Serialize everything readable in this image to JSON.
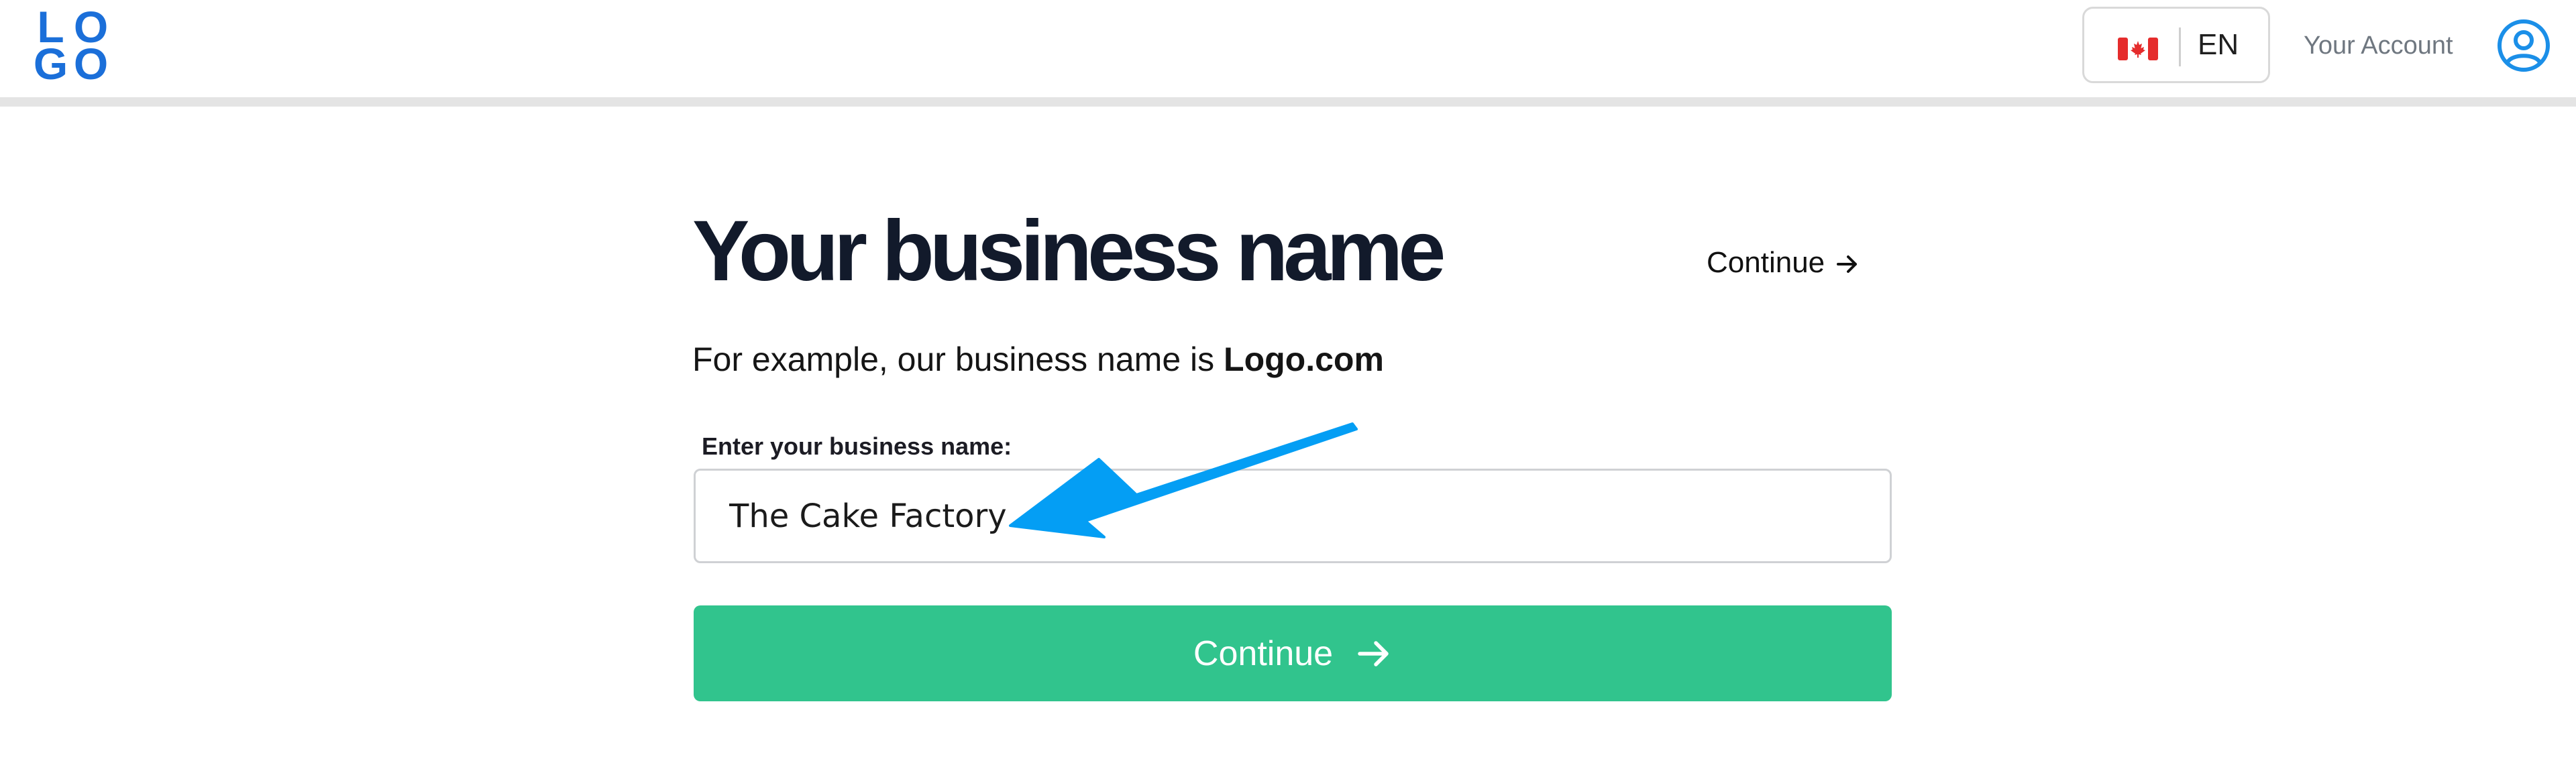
{
  "header": {
    "logo_line1": [
      "L",
      "O"
    ],
    "logo_line2": [
      "G",
      "O"
    ],
    "language": {
      "flag_icon": "canada-flag-icon",
      "code": "EN"
    },
    "account_label": "Your Account",
    "account_icon": "user-circle-icon",
    "brand_color": "#1b6fd9"
  },
  "main": {
    "title": "Your business name",
    "skip_label": "Continue",
    "skip_icon": "arrow-right-icon",
    "example_prefix": "For example, our business name is ",
    "example_name": "Logo.com",
    "field_label": "Enter your business name:",
    "business_name_value": "The Cake Factory",
    "continue_label": "Continue",
    "continue_icon": "arrow-right-icon",
    "accent_color": "#31c48d",
    "annotation_color": "#049ef4"
  }
}
